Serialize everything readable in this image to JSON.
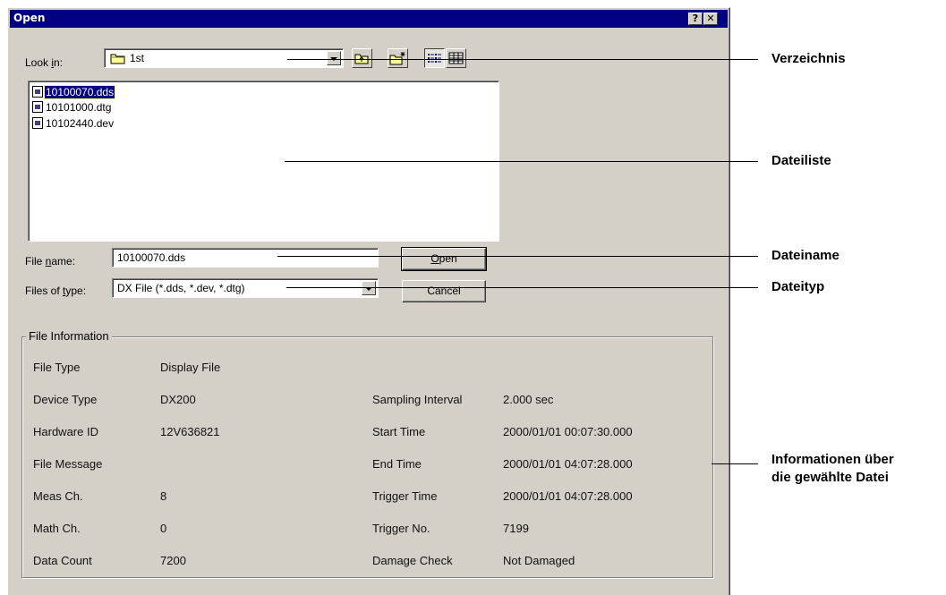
{
  "dialog": {
    "title": "Open",
    "help_button": "?",
    "close_button": "✕"
  },
  "look_in": {
    "label_pre": "Look ",
    "label_accel": "i",
    "label_post": "n:",
    "value": "1st"
  },
  "files": [
    {
      "name": "10100070.dds",
      "selected": true
    },
    {
      "name": "10101000.dtg",
      "selected": false
    },
    {
      "name": "10102440.dev",
      "selected": false
    }
  ],
  "file_name": {
    "label_pre": "File ",
    "label_accel": "n",
    "label_post": "ame:",
    "value": "10100070.dds"
  },
  "file_type": {
    "label_pre": "Files of ",
    "label_accel": "t",
    "label_post": "ype:",
    "value": "DX File (*.dds, *.dev, *.dtg)"
  },
  "buttons": {
    "open_accel": "O",
    "open_rest": "pen",
    "cancel": "Cancel"
  },
  "file_info": {
    "title": "File Information",
    "left": [
      {
        "label": "File Type",
        "value": "Display File"
      },
      {
        "label": "Device Type",
        "value": "DX200"
      },
      {
        "label": "Hardware ID",
        "value": "12V636821"
      },
      {
        "label": "File Message",
        "value": ""
      },
      {
        "label": "Meas Ch.",
        "value": "8"
      },
      {
        "label": "Math Ch.",
        "value": "0"
      },
      {
        "label": "Data Count",
        "value": "7200"
      }
    ],
    "right": [
      {
        "label": "Sampling Interval",
        "value": "2.000 sec"
      },
      {
        "label": "Start Time",
        "value": "2000/01/01 00:07:30.000"
      },
      {
        "label": "End Time",
        "value": "2000/01/01 04:07:28.000"
      },
      {
        "label": "Trigger Time",
        "value": "2000/01/01 04:07:28.000"
      },
      {
        "label": "Trigger No.",
        "value": "7199"
      },
      {
        "label": "Damage Check",
        "value": "Not Damaged"
      }
    ]
  },
  "callouts": {
    "directory": "Verzeichnis",
    "file_list": "Dateiliste",
    "file_name": "Dateiname",
    "file_type": "Dateityp",
    "info_line1": "Informationen über",
    "info_line2": "die gewählte Datei"
  }
}
